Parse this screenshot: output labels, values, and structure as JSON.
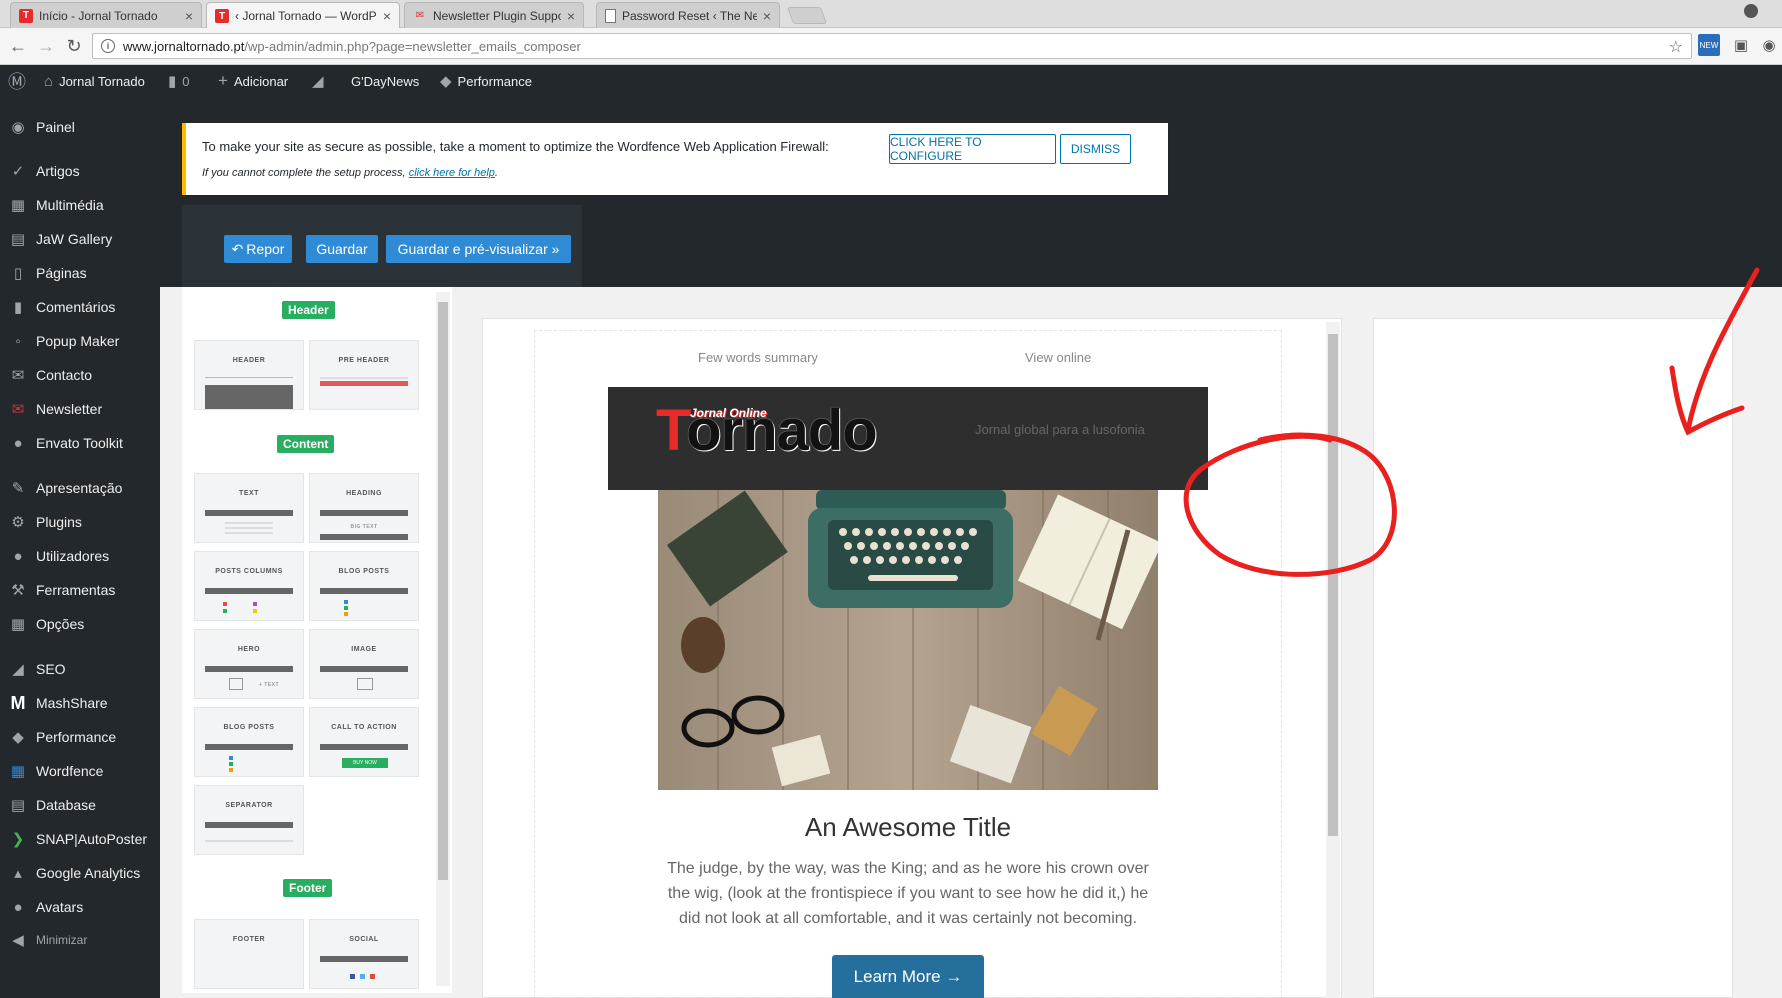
{
  "browser": {
    "tabs": [
      {
        "title": "Início - Jornal Tornado",
        "favicon": "tornado-t-icon"
      },
      {
        "title": "‹ Jornal Tornado — WordPress",
        "favicon": "tornado-t-icon"
      },
      {
        "title": "Newsletter Plugin Support",
        "favicon": "newsletter-icon"
      },
      {
        "title": "Password Reset ‹ The Newsletter",
        "favicon": "document-icon"
      }
    ],
    "close_glyph": "×",
    "url_host": "www.jornaltornado.pt",
    "url_path": "/wp-admin/admin.php?page=newsletter_emails_composer",
    "ext_new_label": "NEW"
  },
  "adminbar": {
    "site_name": "Jornal Tornado",
    "comments_count": "0",
    "add_label": "Adicionar",
    "gdaynews_label": "G'DayNews",
    "performance_label": "Performance"
  },
  "sidebar": {
    "items": [
      {
        "label": "Painel",
        "icon": "dashboard-icon"
      },
      {
        "label": "Artigos",
        "icon": "pin-icon"
      },
      {
        "label": "Multimédia",
        "icon": "media-icon"
      },
      {
        "label": "JaW Gallery",
        "icon": "gallery-icon"
      },
      {
        "label": "Páginas",
        "icon": "pages-icon"
      },
      {
        "label": "Comentários",
        "icon": "comment-icon"
      },
      {
        "label": "Popup Maker",
        "icon": "popup-icon"
      },
      {
        "label": "Contacto",
        "icon": "mail-icon"
      },
      {
        "label": "Newsletter",
        "icon": "newsletter-icon"
      },
      {
        "label": "Envato Toolkit",
        "icon": "envato-icon"
      },
      {
        "label": "Apresentação",
        "icon": "brush-icon"
      },
      {
        "label": "Plugins",
        "icon": "plugin-icon"
      },
      {
        "label": "Utilizadores",
        "icon": "user-icon"
      },
      {
        "label": "Ferramentas",
        "icon": "wrench-icon"
      },
      {
        "label": "Opções",
        "icon": "settings-icon"
      },
      {
        "label": "SEO",
        "icon": "seo-icon"
      },
      {
        "label": "MashShare",
        "icon": "mashshare-icon"
      },
      {
        "label": "Performance",
        "icon": "performance-icon"
      },
      {
        "label": "Wordfence",
        "icon": "wordfence-icon"
      },
      {
        "label": "Database",
        "icon": "database-icon"
      },
      {
        "label": "SNAP|AutoPoster",
        "icon": "snap-icon"
      },
      {
        "label": "Google Analytics",
        "icon": "analytics-icon"
      },
      {
        "label": "Avatars",
        "icon": "avatar-icon"
      }
    ],
    "minimize_label": "Minimizar"
  },
  "notice": {
    "text": "To make your site as secure as possible, take a moment to optimize the Wordfence Web Application Firewall:",
    "configure_label": "CLICK HERE TO CONFIGURE",
    "dismiss_label": "DISMISS",
    "sub_text": "If you cannot complete the setup process, ",
    "sub_link": "click here for help",
    "sub_end": "."
  },
  "composer_toolbar": {
    "reset_label": "Repor",
    "save_label": "Guardar",
    "save_preview_label": "Guardar e pré-visualizar »"
  },
  "palette": {
    "header_label": "Header",
    "content_label": "Content",
    "footer_label": "Footer",
    "blocks": {
      "header": "HEADER",
      "preheader": "PRE HEADER",
      "text": "TEXT",
      "heading": "HEADING",
      "heading_sub": "BIG TEXT",
      "posts_columns": "POSTS COLUMNS",
      "blog_posts_a": "BLOG POSTS",
      "hero": "HERO",
      "hero_sub": "+ TEXT",
      "image": "IMAGE",
      "blog_posts_b": "BLOG POSTS",
      "cta": "CALL TO ACTION",
      "cta_sub": "BUY NOW",
      "separator": "SEPARATOR",
      "footer": "FOOTER",
      "social": "SOCIAL"
    }
  },
  "email": {
    "summary": "Few words summary",
    "view_online": "View online",
    "logo_small": "Jornal Online",
    "logo_t": "T",
    "logo_rest": "ornado",
    "tagline": "Jornal global para a lusofonia",
    "title": "An Awesome Title",
    "body": "The judge, by the way, was the King; and as he wore his crown over the wig, (look at the frontispiece if you want to see how he did it,) he did not look at all comfortable, and it was certainly not becoming.",
    "button_label": "Learn More →"
  },
  "colors": {
    "admin_dark": "#23282d",
    "accent_blue": "#2f8bd6",
    "palette_green": "#27ae60",
    "notice_yellow": "#ffb900",
    "annotation_red": "#e8201e"
  }
}
